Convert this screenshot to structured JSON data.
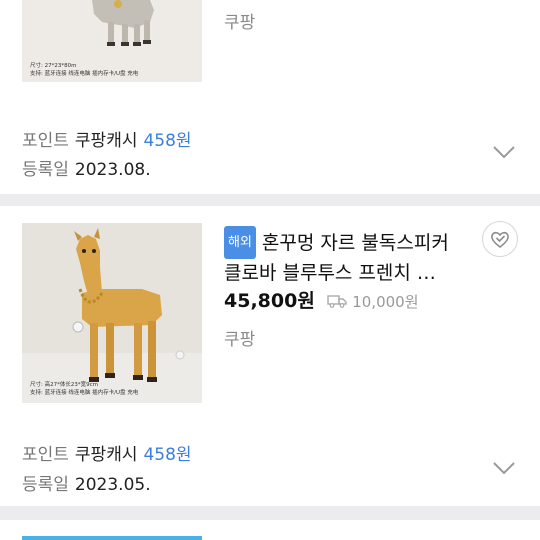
{
  "listing_1": {
    "spec_lines": [
      "尺寸: 27*23*80m",
      "支持: 蓝牙连接  线连电脑  插内存卡/U盘  充电"
    ],
    "seller": "쿠팡",
    "cash_prefix": "포인트",
    "cash_label": "쿠팡캐시",
    "cash_points": "458원",
    "date_label": "등록일",
    "date_value": "2023.08."
  },
  "listing_2": {
    "badge": "해외",
    "title_line1": "혼꾸멍 자르 불독스피커",
    "title_line2": "클로바 블루투스 프렌치 …",
    "price": "45,800원",
    "shipping_fee": "10,000원",
    "seller": "쿠팡",
    "spec_lines": [
      "尺寸: 高27*体长23*宽9cm",
      "支持: 蓝牙连接  线连电脑  插内存卡/U盘  充电"
    ],
    "cash_prefix": "포인트",
    "cash_label": "쿠팡캐시",
    "cash_points": "458원",
    "date_label": "등록일",
    "date_value": "2023.05."
  },
  "icons": {
    "chevron": "chevron-down-icon",
    "wishlist": "heart-check-icon",
    "truck": "truck-icon"
  },
  "colors": {
    "accent_blue": "#3b7ee0",
    "badge_blue": "#4a8ee6",
    "divider": "#ececee"
  }
}
